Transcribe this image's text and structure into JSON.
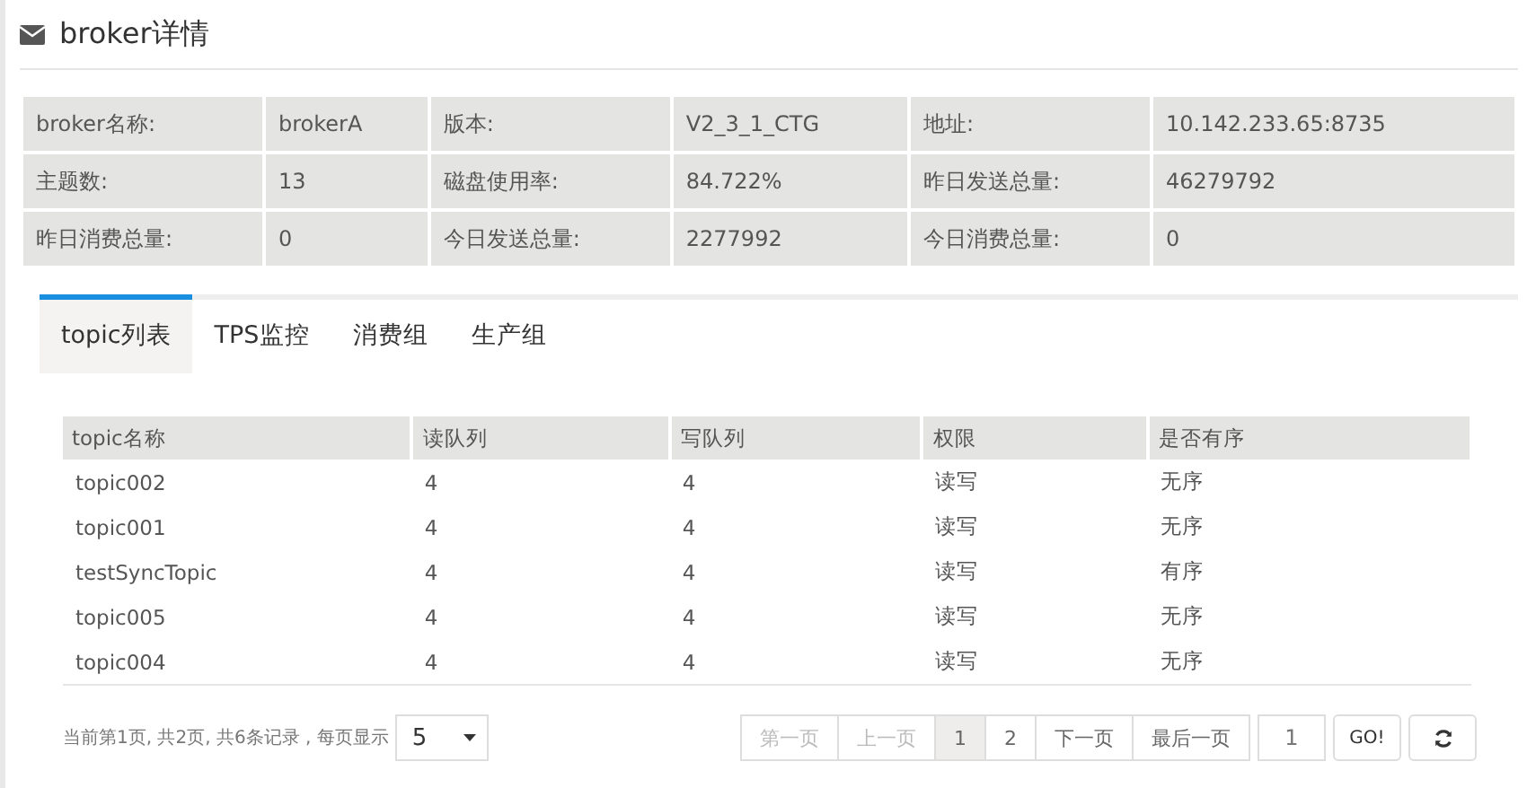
{
  "header": {
    "title": "broker详情"
  },
  "info": [
    [
      {
        "label": "broker名称:",
        "value": "brokerA"
      },
      {
        "label": "版本:",
        "value": "V2_3_1_CTG"
      },
      {
        "label": "地址:",
        "value": "10.142.233.65:8735"
      }
    ],
    [
      {
        "label": "主题数:",
        "value": "13"
      },
      {
        "label": "磁盘使用率:",
        "value": "84.722%"
      },
      {
        "label": "昨日发送总量:",
        "value": "46279792"
      }
    ],
    [
      {
        "label": "昨日消费总量:",
        "value": "0"
      },
      {
        "label": "今日发送总量:",
        "value": "2277992"
      },
      {
        "label": "今日消费总量:",
        "value": "0"
      }
    ]
  ],
  "tabs": [
    {
      "label": "topic列表",
      "selected": true
    },
    {
      "label": "TPS监控",
      "selected": false
    },
    {
      "label": "消费组",
      "selected": false
    },
    {
      "label": "生产组",
      "selected": false
    }
  ],
  "table": {
    "columns": [
      "topic名称",
      "读队列",
      "写队列",
      "权限",
      "是否有序"
    ],
    "rows": [
      [
        "topic002",
        "4",
        "4",
        "读写",
        "无序"
      ],
      [
        "topic001",
        "4",
        "4",
        "读写",
        "无序"
      ],
      [
        "testSyncTopic",
        "4",
        "4",
        "读写",
        "有序"
      ],
      [
        "topic005",
        "4",
        "4",
        "读写",
        "无序"
      ],
      [
        "topic004",
        "4",
        "4",
        "读写",
        "无序"
      ]
    ]
  },
  "pagination": {
    "summary": "当前第1页, 共2页, 共6条记录 , 每页显示",
    "page_size": "5",
    "buttons": [
      {
        "kind": "nav",
        "label": "第一页",
        "disabled": true
      },
      {
        "kind": "nav",
        "label": "上一页",
        "disabled": true
      },
      {
        "kind": "page",
        "label": "1",
        "selected": true
      },
      {
        "kind": "page",
        "label": "2",
        "selected": false
      },
      {
        "kind": "nav",
        "label": "下一页",
        "disabled": false
      },
      {
        "kind": "nav",
        "label": "最后一页",
        "disabled": false
      }
    ],
    "goto_value": "1",
    "go_label": "GO!"
  }
}
